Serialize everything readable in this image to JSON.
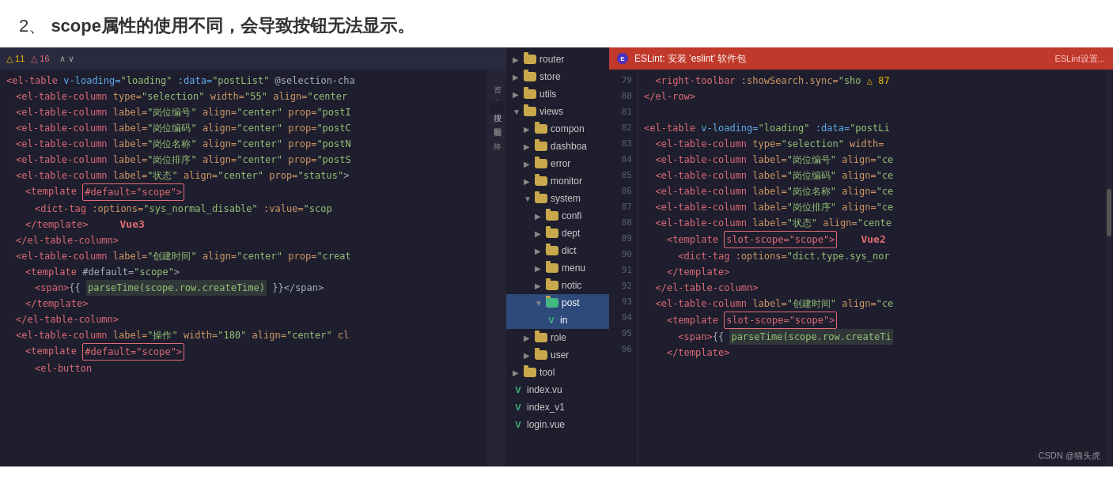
{
  "page": {
    "title_prefix": "2、",
    "title_main": "scope属性的使用不同，会导致按钮无法显示。"
  },
  "left_panel": {
    "warning_count": "△ 11",
    "error_count": "△ 16",
    "nav": "∧ ∨",
    "side_tabs": [
      "资",
      "文",
      "搜",
      "控制器",
      "终"
    ],
    "vue_label": "Vue3",
    "code_lines": [
      "<el-table v-loading=\"loading\" :data=\"postList\" @selection-cha",
      "  <el-table-column type=\"selection\" width=\"55\" align=\"center",
      "  <el-table-column label=\"岗位编号\" align=\"center\" prop=\"postI",
      "  <el-table-column label=\"岗位编码\" align=\"center\" prop=\"postC",
      "  <el-table-column label=\"岗位名称\" align=\"center\" prop=\"postN",
      "  <el-table-column label=\"岗位排序\" align=\"center\" prop=\"postS",
      "  <el-table-column label=\"状态\" align=\"center\" prop=\"status\">",
      "    <template #default=\"scope\">",
      "      <dict-tag :options=\"sys_normal_disable\" :value=\"scop",
      "    </template>",
      "  </el-table-column>",
      "  <el-table-column label=\"创建时间\" align=\"center\" prop=\"creat",
      "    <template #default=\"scope\">",
      "      <span>{{ parseTime(scope.row.createTime) }}</span>",
      "    </template>",
      "  </el-table-column>",
      "  <el-table-column label=\"操作\" width=\"180\" align=\"center\" cl",
      "    <template #default=\"scope\">",
      "      <el-button"
    ]
  },
  "file_tree": {
    "items": [
      {
        "type": "folder",
        "name": "router",
        "indent": 1,
        "expanded": false
      },
      {
        "type": "folder",
        "name": "store",
        "indent": 1,
        "expanded": false
      },
      {
        "type": "folder",
        "name": "utils",
        "indent": 1,
        "expanded": false
      },
      {
        "type": "folder",
        "name": "views",
        "indent": 1,
        "expanded": true
      },
      {
        "type": "folder",
        "name": "compon",
        "indent": 2,
        "expanded": false
      },
      {
        "type": "folder",
        "name": "dashboa",
        "indent": 2,
        "expanded": false
      },
      {
        "type": "folder",
        "name": "error",
        "indent": 2,
        "expanded": false
      },
      {
        "type": "folder",
        "name": "monitor",
        "indent": 2,
        "expanded": false
      },
      {
        "type": "folder",
        "name": "system",
        "indent": 2,
        "expanded": true
      },
      {
        "type": "folder",
        "name": "confi",
        "indent": 3,
        "expanded": false
      },
      {
        "type": "folder",
        "name": "dept",
        "indent": 3,
        "expanded": false
      },
      {
        "type": "folder",
        "name": "dict",
        "indent": 3,
        "expanded": false
      },
      {
        "type": "folder",
        "name": "menu",
        "indent": 3,
        "expanded": false
      },
      {
        "type": "folder",
        "name": "notic",
        "indent": 3,
        "expanded": false
      },
      {
        "type": "folder",
        "name": "post",
        "indent": 3,
        "expanded": true,
        "active": true
      },
      {
        "type": "file-vue",
        "name": "in",
        "indent": 4,
        "active": true
      },
      {
        "type": "folder",
        "name": "role",
        "indent": 2,
        "expanded": false
      },
      {
        "type": "folder",
        "name": "user",
        "indent": 2,
        "expanded": false
      },
      {
        "type": "folder",
        "name": "tool",
        "indent": 1,
        "expanded": false
      },
      {
        "type": "file-vue",
        "name": "index.vu",
        "indent": 1
      },
      {
        "type": "file-vue",
        "name": "index_v1",
        "indent": 1
      },
      {
        "type": "file-vue",
        "name": "login.vue",
        "indent": 1
      }
    ],
    "line_numbers": [
      "79",
      "80",
      "81",
      "82",
      "83",
      "84",
      "85",
      "86",
      "87",
      "88",
      "89",
      "90",
      "91",
      "92",
      "93",
      "94",
      "95",
      "96"
    ]
  },
  "right_panel": {
    "header": {
      "icon": "E",
      "title": "ESLint: 安装 'eslint' 软件包",
      "link": "ESLint设置..."
    },
    "vue_label": "Vue2",
    "code_lines": [
      "  <right-toolbar :showSearch.sync=\"sho  △ 87",
      "</el-row>",
      "",
      "<el-table v-loading=\"loading\" :data=\"postLi",
      "  <el-table-column type=\"selection\" width=",
      "  <el-table-column label=\"岗位编号\" align=\"ce",
      "  <el-table-column label=\"岗位编码\" align=\"ce",
      "  <el-table-column label=\"岗位名称\" align=\"ce",
      "  <el-table-column label=\"岗位排序\" align=\"ce",
      "  <el-table-column label=\"状态\" align=\"cente",
      "    <template slot-scope=\"scope\">",
      "      <dict-tag :options=\"dict.type.sys_nor",
      "    </template>",
      "  </el-table-column>",
      "  <el-table-column label=\"创建时间\" align=\"ce",
      "    <template slot-scope=\"scope\">",
      "      <span>{{ parseTime(scope.row.createTi",
      "    </template>"
    ],
    "line_numbers": [
      "79",
      "80",
      "81",
      "82",
      "83",
      "84",
      "85",
      "86",
      "87",
      "88",
      "89",
      "90",
      "91",
      "92",
      "93",
      "94",
      "95",
      "96"
    ]
  },
  "watermark": "CSDN @猫头虎"
}
